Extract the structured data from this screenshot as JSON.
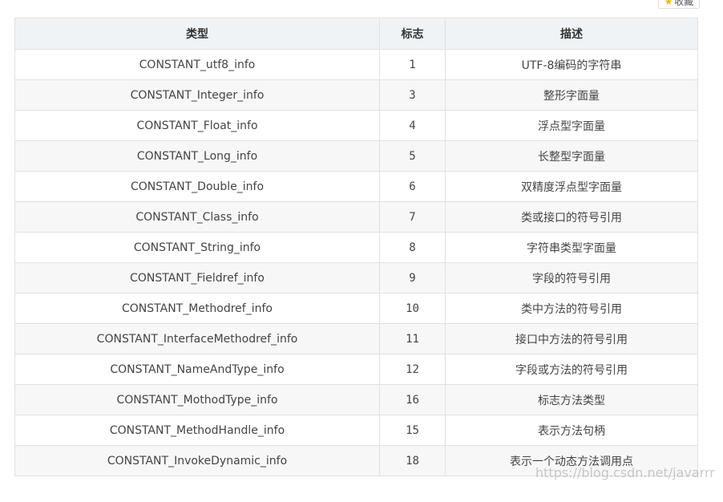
{
  "favorite_button": {
    "label": "收藏",
    "icon": "star-icon"
  },
  "table": {
    "headers": {
      "type": "类型",
      "tag": "标志",
      "description": "描述"
    },
    "rows": [
      {
        "type": "CONSTANT_utf8_info",
        "tag": "1",
        "description": "UTF-8编码的字符串"
      },
      {
        "type": "CONSTANT_Integer_info",
        "tag": "3",
        "description": "整形字面量"
      },
      {
        "type": "CONSTANT_Float_info",
        "tag": "4",
        "description": "浮点型字面量"
      },
      {
        "type": "CONSTANT_Long_info",
        "tag": "5",
        "description": "长整型字面量"
      },
      {
        "type": "CONSTANT_Double_info",
        "tag": "6",
        "description": "双精度浮点型字面量"
      },
      {
        "type": "CONSTANT_Class_info",
        "tag": "7",
        "description": "类或接口的符号引用"
      },
      {
        "type": "CONSTANT_String_info",
        "tag": "8",
        "description": "字符串类型字面量"
      },
      {
        "type": "CONSTANT_Fieldref_info",
        "tag": "9",
        "description": "字段的符号引用"
      },
      {
        "type": "CONSTANT_Methodref_info",
        "tag": "10",
        "description": "类中方法的符号引用"
      },
      {
        "type": "CONSTANT_InterfaceMethodref_info",
        "tag": "11",
        "description": "接口中方法的符号引用"
      },
      {
        "type": "CONSTANT_NameAndType_info",
        "tag": "12",
        "description": "字段或方法的符号引用"
      },
      {
        "type": "CONSTANT_MothodType_info",
        "tag": "16",
        "description": "标志方法类型"
      },
      {
        "type": "CONSTANT_MethodHandle_info",
        "tag": "15",
        "description": "表示方法句柄"
      },
      {
        "type": "CONSTANT_InvokeDynamic_info",
        "tag": "18",
        "description": "表示一个动态方法调用点"
      }
    ]
  },
  "watermark": "https://blog.csdn.net/javarrr"
}
